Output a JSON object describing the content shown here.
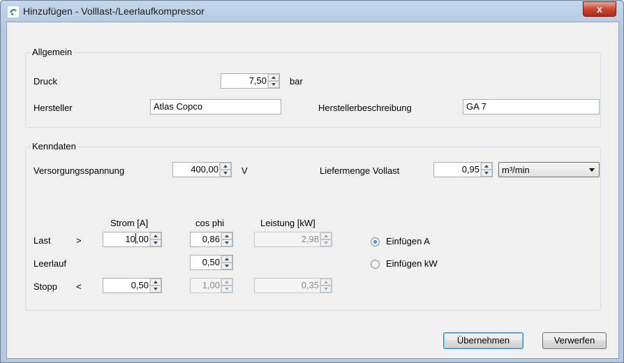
{
  "window": {
    "title": "Hinzufügen - Volllast-/Leerlaufkompressor",
    "close_label": "x"
  },
  "allgemein": {
    "legend": "Allgemein",
    "druck_label": "Druck",
    "druck_value": "7,50",
    "druck_unit": "bar",
    "hersteller_label": "Hersteller",
    "hersteller_value": "Atlas Copco",
    "beschreibung_label": "Herstellerbeschreibung",
    "beschreibung_value": "GA 7"
  },
  "kenndaten": {
    "legend": "Kenndaten",
    "spannung_label": "Versorgungsspannung",
    "spannung_value": "400,00",
    "spannung_unit": "V",
    "liefermenge_label": "Liefermenge Vollast",
    "liefermenge_value": "0,95",
    "liefermenge_unit": "m³/min",
    "columns": {
      "strom": "Strom [A]",
      "cosphi": "cos phi",
      "leistung": "Leistung [kW]"
    },
    "rows": {
      "last": {
        "label": "Last",
        "op": ">",
        "strom_before": "10",
        "strom_after": ",00",
        "cosphi": "0,86",
        "leistung": "2,98"
      },
      "leerlauf": {
        "label": "Leerlauf",
        "cosphi": "0,50"
      },
      "stopp": {
        "label": "Stopp",
        "op": "<",
        "strom": "0,50",
        "cosphi": "1,00",
        "leistung": "0,35"
      }
    },
    "radio_a": {
      "label": "Einfügen A",
      "checked": true
    },
    "radio_kw": {
      "label": "Einfügen kW",
      "checked": false
    }
  },
  "buttons": {
    "ok": "Übernehmen",
    "cancel": "Verwerfen"
  },
  "colors": {
    "title_bar": "#b5c9e2",
    "close": "#c9462f",
    "dialog_bg": "#f0f0f0"
  }
}
